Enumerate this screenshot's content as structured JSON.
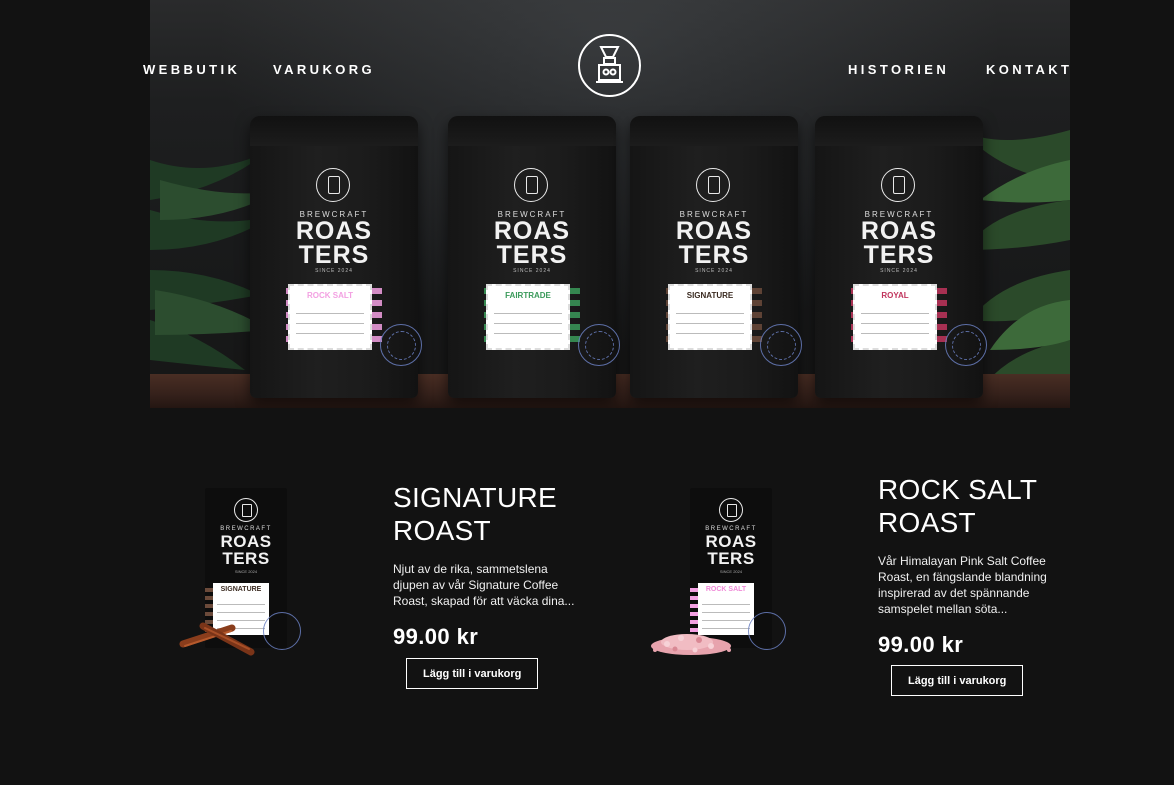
{
  "nav": {
    "left": [
      "WEBBUTIK",
      "VARUKORG"
    ],
    "right": [
      "HISTORIEN",
      "KONTAKT"
    ],
    "logo_icon": "coffee-brewer-logo-icon"
  },
  "hero": {
    "bags": [
      {
        "brand_top": "BREWCRAFT",
        "brand_line1": "ROAS",
        "brand_line2": "TERS",
        "since": "SINCE 2024",
        "label": "ROCK SALT",
        "color": "#f3a0e2"
      },
      {
        "brand_top": "BREWCRAFT",
        "brand_line1": "ROAS",
        "brand_line2": "TERS",
        "since": "SINCE 2024",
        "label": "FAIRTRADE",
        "color": "#3a9a5a"
      },
      {
        "brand_top": "BREWCRAFT",
        "brand_line1": "ROAS",
        "brand_line2": "TERS",
        "since": "SINCE 2024",
        "label": "SIGNATURE",
        "color": "#6b4a3a"
      },
      {
        "brand_top": "BREWCRAFT",
        "brand_line1": "ROAS",
        "brand_line2": "TERS",
        "since": "SINCE 2024",
        "label": "ROYAL",
        "color": "#c0345c"
      }
    ]
  },
  "products": [
    {
      "title_line1": "SIGNATURE",
      "title_line2": "ROAST",
      "description": "Njut av de rika, sammetslena djupen av vår Signature Coffee Roast, skapad för att väcka dina...",
      "price": "99.00 kr",
      "button": "Lägg till i varukorg",
      "bag_label": "SIGNATURE",
      "bag_color": "#6b4a3a",
      "brand_top": "BREWCRAFT",
      "brand_line1": "ROAS",
      "brand_line2": "TERS",
      "since": "SINCE 2024"
    },
    {
      "title_line1": "ROCK SALT",
      "title_line2": "ROAST",
      "description": "Vår Himalayan Pink Salt Coffee Roast, en fängslande blandning inspirerad av det spännande samspelet mellan söta...",
      "price": "99.00 kr",
      "button": "Lägg till i varukorg",
      "bag_label": "ROCK SALT",
      "bag_color": "#f3a0e2",
      "brand_top": "BREWCRAFT",
      "brand_line1": "ROAS",
      "brand_line2": "TERS",
      "since": "SINCE 2024"
    }
  ]
}
